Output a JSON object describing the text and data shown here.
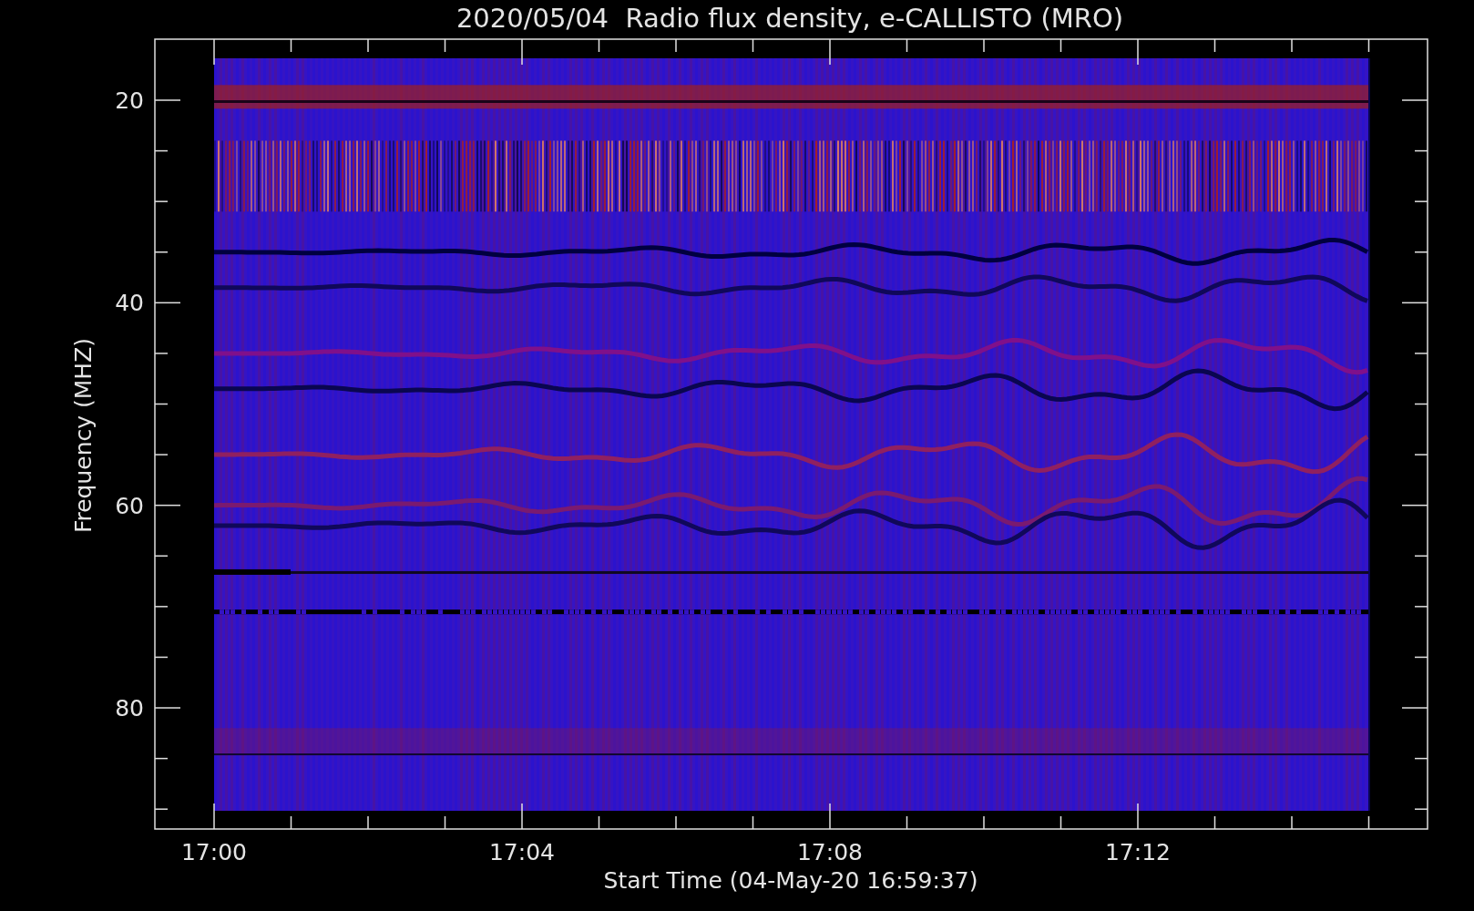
{
  "title": "2020/05/04  Radio flux density, e-CALLISTO (MRO)",
  "y_axis": {
    "label": "Frequency (MHZ)",
    "ticks": [
      "20",
      "40",
      "60",
      "80"
    ]
  },
  "x_axis": {
    "label": "Start Time (04-May-20 16:59:37)",
    "ticks": [
      "17:00",
      "17:04",
      "17:08",
      "17:12"
    ]
  }
}
